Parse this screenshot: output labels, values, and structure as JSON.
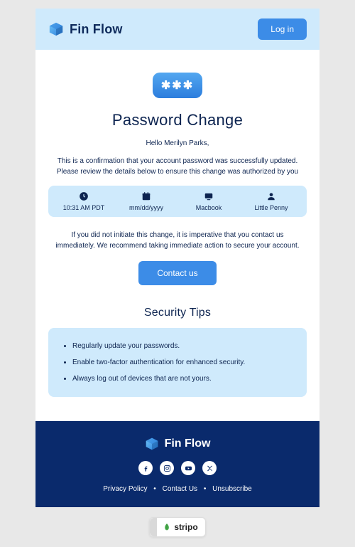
{
  "header": {
    "brand": "Fin Flow",
    "login_label": "Log in"
  },
  "main": {
    "title": "Password Change",
    "greeting": "Hello Merilyn Parks,",
    "para1": "This is a confirmation that your account password was successfully updated. Please review the details below to ensure this change was authorized by you",
    "details": {
      "time": "10:31 AM PDT",
      "date": "mm/dd/yyyy",
      "device": "Macbook",
      "location": "Little Penny"
    },
    "para2": "If you did not initiate this change, it is imperative that you contact us immediately. We recommend taking immediate action to secure your account.",
    "contact_label": "Contact us",
    "tips_title": "Security Tips",
    "tips": [
      "Regularly update your passwords.",
      "Enable two-factor authentication for enhanced security.",
      "Always log out of devices that are not yours."
    ]
  },
  "footer": {
    "brand": "Fin Flow",
    "links": {
      "privacy": "Privacy Policy",
      "contact": "Contact Us",
      "unsubscribe": "Unsubscribe"
    }
  },
  "badge": {
    "text": "stripo"
  }
}
